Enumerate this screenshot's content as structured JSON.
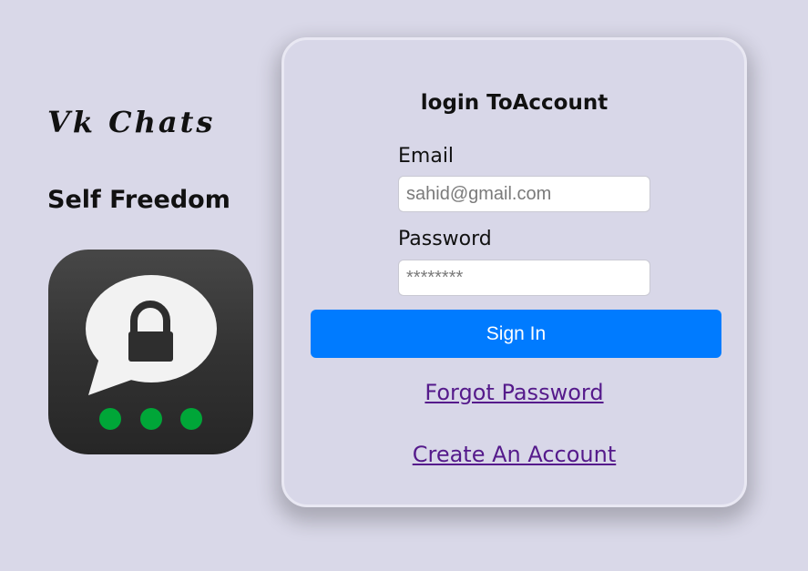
{
  "brand": {
    "title": "Vk Chats",
    "tagline": "Self Freedom",
    "logo_icon": "chat-lock-icon",
    "logo_colors": {
      "tile": "#2e2e2e",
      "bubble": "#f2f2f2",
      "lock": "#2e2e2e",
      "dots": "#00a638"
    }
  },
  "login": {
    "title": "login ToAccount",
    "email_label": "Email",
    "email_placeholder": "sahid@gmail.com",
    "password_label": "Password",
    "password_placeholder": "********",
    "signin_label": "Sign In",
    "forgot_label": "Forgot Password",
    "create_label": "Create An Account",
    "accent_color": "#007bff",
    "link_color": "#551a8b"
  },
  "page": {
    "background_color": "#d9d8e8"
  }
}
